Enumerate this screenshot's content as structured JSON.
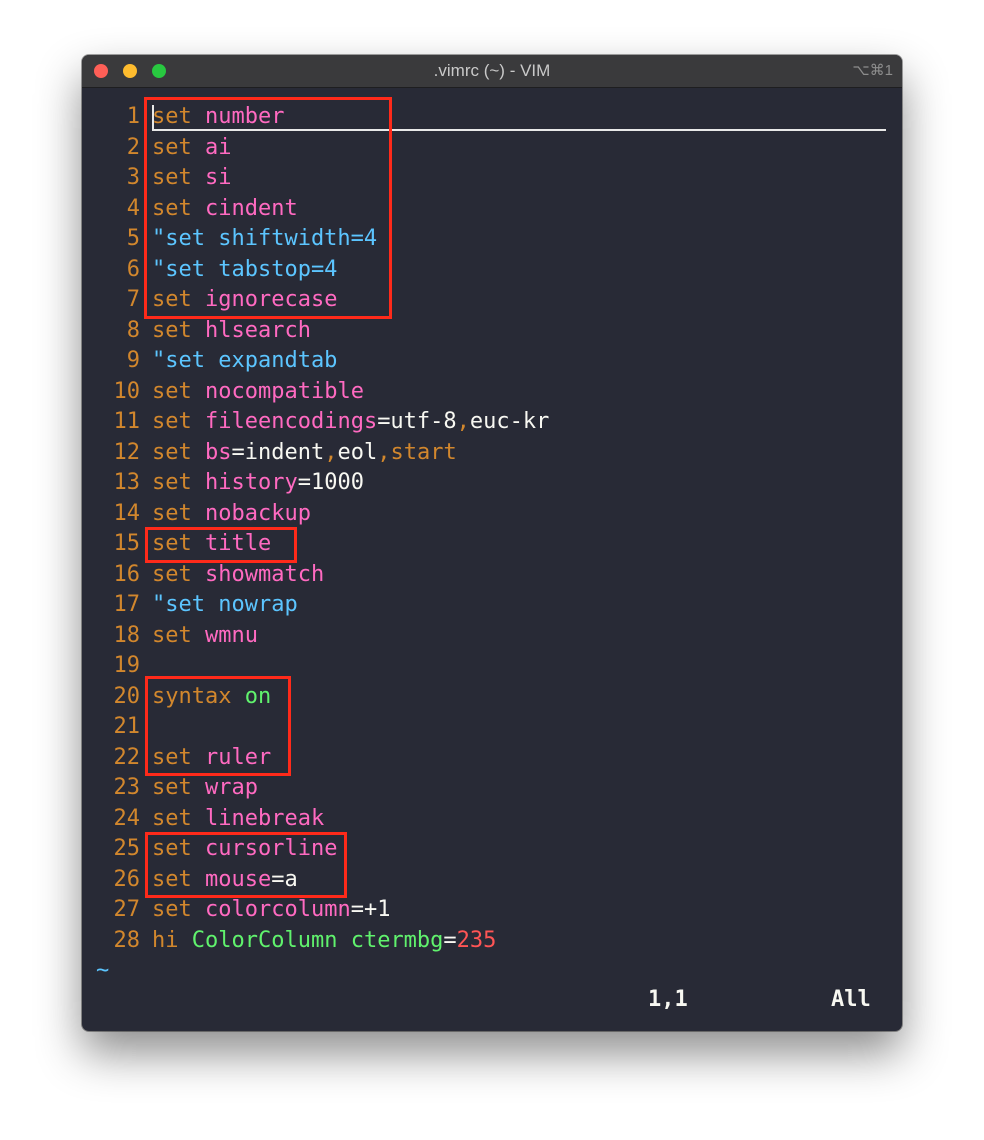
{
  "window": {
    "title": ".vimrc (~) - VIM",
    "shortcut": "⌥⌘1"
  },
  "colors": {
    "background": "#282a36",
    "line_number": "#d2872d",
    "keyword": "#d2872d",
    "option": "#ff6ac1",
    "comment": "#5cc5ff",
    "highlight_box": "#ff2a1a"
  },
  "editor": {
    "lines": [
      {
        "num": "1",
        "segments": [
          {
            "text": "set",
            "cls": "kw"
          },
          {
            "text": " ",
            "cls": "white"
          },
          {
            "text": "number",
            "cls": "opt"
          }
        ]
      },
      {
        "num": "2",
        "segments": [
          {
            "text": "set",
            "cls": "kw"
          },
          {
            "text": " ",
            "cls": "white"
          },
          {
            "text": "ai",
            "cls": "opt"
          }
        ]
      },
      {
        "num": "3",
        "segments": [
          {
            "text": "set",
            "cls": "kw"
          },
          {
            "text": " ",
            "cls": "white"
          },
          {
            "text": "si",
            "cls": "opt"
          }
        ]
      },
      {
        "num": "4",
        "segments": [
          {
            "text": "set",
            "cls": "kw"
          },
          {
            "text": " ",
            "cls": "white"
          },
          {
            "text": "cindent",
            "cls": "opt"
          }
        ]
      },
      {
        "num": "5",
        "segments": [
          {
            "text": "\"set shiftwidth=4",
            "cls": "cmt"
          }
        ]
      },
      {
        "num": "6",
        "segments": [
          {
            "text": "\"set tabstop=4",
            "cls": "cmt"
          }
        ]
      },
      {
        "num": "7",
        "segments": [
          {
            "text": "set",
            "cls": "kw"
          },
          {
            "text": " ",
            "cls": "white"
          },
          {
            "text": "ignorecase",
            "cls": "opt"
          }
        ]
      },
      {
        "num": "8",
        "segments": [
          {
            "text": "set",
            "cls": "kw"
          },
          {
            "text": " ",
            "cls": "white"
          },
          {
            "text": "hlsearch",
            "cls": "opt"
          }
        ]
      },
      {
        "num": "9",
        "segments": [
          {
            "text": "\"set expandtab",
            "cls": "cmt"
          }
        ]
      },
      {
        "num": "10",
        "segments": [
          {
            "text": "set",
            "cls": "kw"
          },
          {
            "text": " ",
            "cls": "white"
          },
          {
            "text": "nocompatible",
            "cls": "opt"
          }
        ]
      },
      {
        "num": "11",
        "segments": [
          {
            "text": "set",
            "cls": "kw"
          },
          {
            "text": " ",
            "cls": "white"
          },
          {
            "text": "fileencodings",
            "cls": "opt"
          },
          {
            "text": "=utf-8",
            "cls": "white"
          },
          {
            "text": ",",
            "cls": "kw"
          },
          {
            "text": "euc-kr",
            "cls": "white"
          }
        ]
      },
      {
        "num": "12",
        "segments": [
          {
            "text": "set",
            "cls": "kw"
          },
          {
            "text": " ",
            "cls": "white"
          },
          {
            "text": "bs",
            "cls": "opt"
          },
          {
            "text": "=indent",
            "cls": "white"
          },
          {
            "text": ",",
            "cls": "kw"
          },
          {
            "text": "eol",
            "cls": "white"
          },
          {
            "text": ",start",
            "cls": "kw"
          }
        ]
      },
      {
        "num": "13",
        "segments": [
          {
            "text": "set",
            "cls": "kw"
          },
          {
            "text": " ",
            "cls": "white"
          },
          {
            "text": "history",
            "cls": "opt"
          },
          {
            "text": "=1000",
            "cls": "white"
          }
        ]
      },
      {
        "num": "14",
        "segments": [
          {
            "text": "set",
            "cls": "kw"
          },
          {
            "text": " ",
            "cls": "white"
          },
          {
            "text": "nobackup",
            "cls": "opt"
          }
        ]
      },
      {
        "num": "15",
        "segments": [
          {
            "text": "set",
            "cls": "kw"
          },
          {
            "text": " ",
            "cls": "white"
          },
          {
            "text": "title",
            "cls": "opt"
          }
        ]
      },
      {
        "num": "16",
        "segments": [
          {
            "text": "set",
            "cls": "kw"
          },
          {
            "text": " ",
            "cls": "white"
          },
          {
            "text": "showmatch",
            "cls": "opt"
          }
        ]
      },
      {
        "num": "17",
        "segments": [
          {
            "text": "\"set nowrap",
            "cls": "cmt"
          }
        ]
      },
      {
        "num": "18",
        "segments": [
          {
            "text": "set",
            "cls": "kw"
          },
          {
            "text": " ",
            "cls": "white"
          },
          {
            "text": "wmnu",
            "cls": "opt"
          }
        ]
      },
      {
        "num": "19",
        "segments": []
      },
      {
        "num": "20",
        "segments": [
          {
            "text": "syntax",
            "cls": "kw"
          },
          {
            "text": " ",
            "cls": "white"
          },
          {
            "text": "on",
            "cls": "green"
          }
        ]
      },
      {
        "num": "21",
        "segments": []
      },
      {
        "num": "22",
        "segments": [
          {
            "text": "set",
            "cls": "kw"
          },
          {
            "text": " ",
            "cls": "white"
          },
          {
            "text": "ruler",
            "cls": "opt"
          }
        ]
      },
      {
        "num": "23",
        "segments": [
          {
            "text": "set",
            "cls": "kw"
          },
          {
            "text": " ",
            "cls": "white"
          },
          {
            "text": "wrap",
            "cls": "opt"
          }
        ]
      },
      {
        "num": "24",
        "segments": [
          {
            "text": "set",
            "cls": "kw"
          },
          {
            "text": " ",
            "cls": "white"
          },
          {
            "text": "linebreak",
            "cls": "opt"
          }
        ]
      },
      {
        "num": "25",
        "segments": [
          {
            "text": "set",
            "cls": "kw"
          },
          {
            "text": " ",
            "cls": "white"
          },
          {
            "text": "cursorline",
            "cls": "opt"
          }
        ]
      },
      {
        "num": "26",
        "segments": [
          {
            "text": "set",
            "cls": "kw"
          },
          {
            "text": " ",
            "cls": "white"
          },
          {
            "text": "mouse",
            "cls": "opt"
          },
          {
            "text": "=a",
            "cls": "white"
          }
        ]
      },
      {
        "num": "27",
        "segments": [
          {
            "text": "set",
            "cls": "kw"
          },
          {
            "text": " ",
            "cls": "white"
          },
          {
            "text": "colorcolumn",
            "cls": "opt"
          },
          {
            "text": "=+1",
            "cls": "white"
          }
        ]
      },
      {
        "num": "28",
        "segments": [
          {
            "text": "hi",
            "cls": "kw"
          },
          {
            "text": " ",
            "cls": "white"
          },
          {
            "text": "ColorColumn",
            "cls": "green"
          },
          {
            "text": " ",
            "cls": "white"
          },
          {
            "text": "ctermbg",
            "cls": "green"
          },
          {
            "text": "=",
            "cls": "white"
          },
          {
            "text": "235",
            "cls": "num"
          }
        ]
      }
    ],
    "tilde": "~"
  },
  "statusline": {
    "position": "1,1",
    "scroll": "All"
  }
}
